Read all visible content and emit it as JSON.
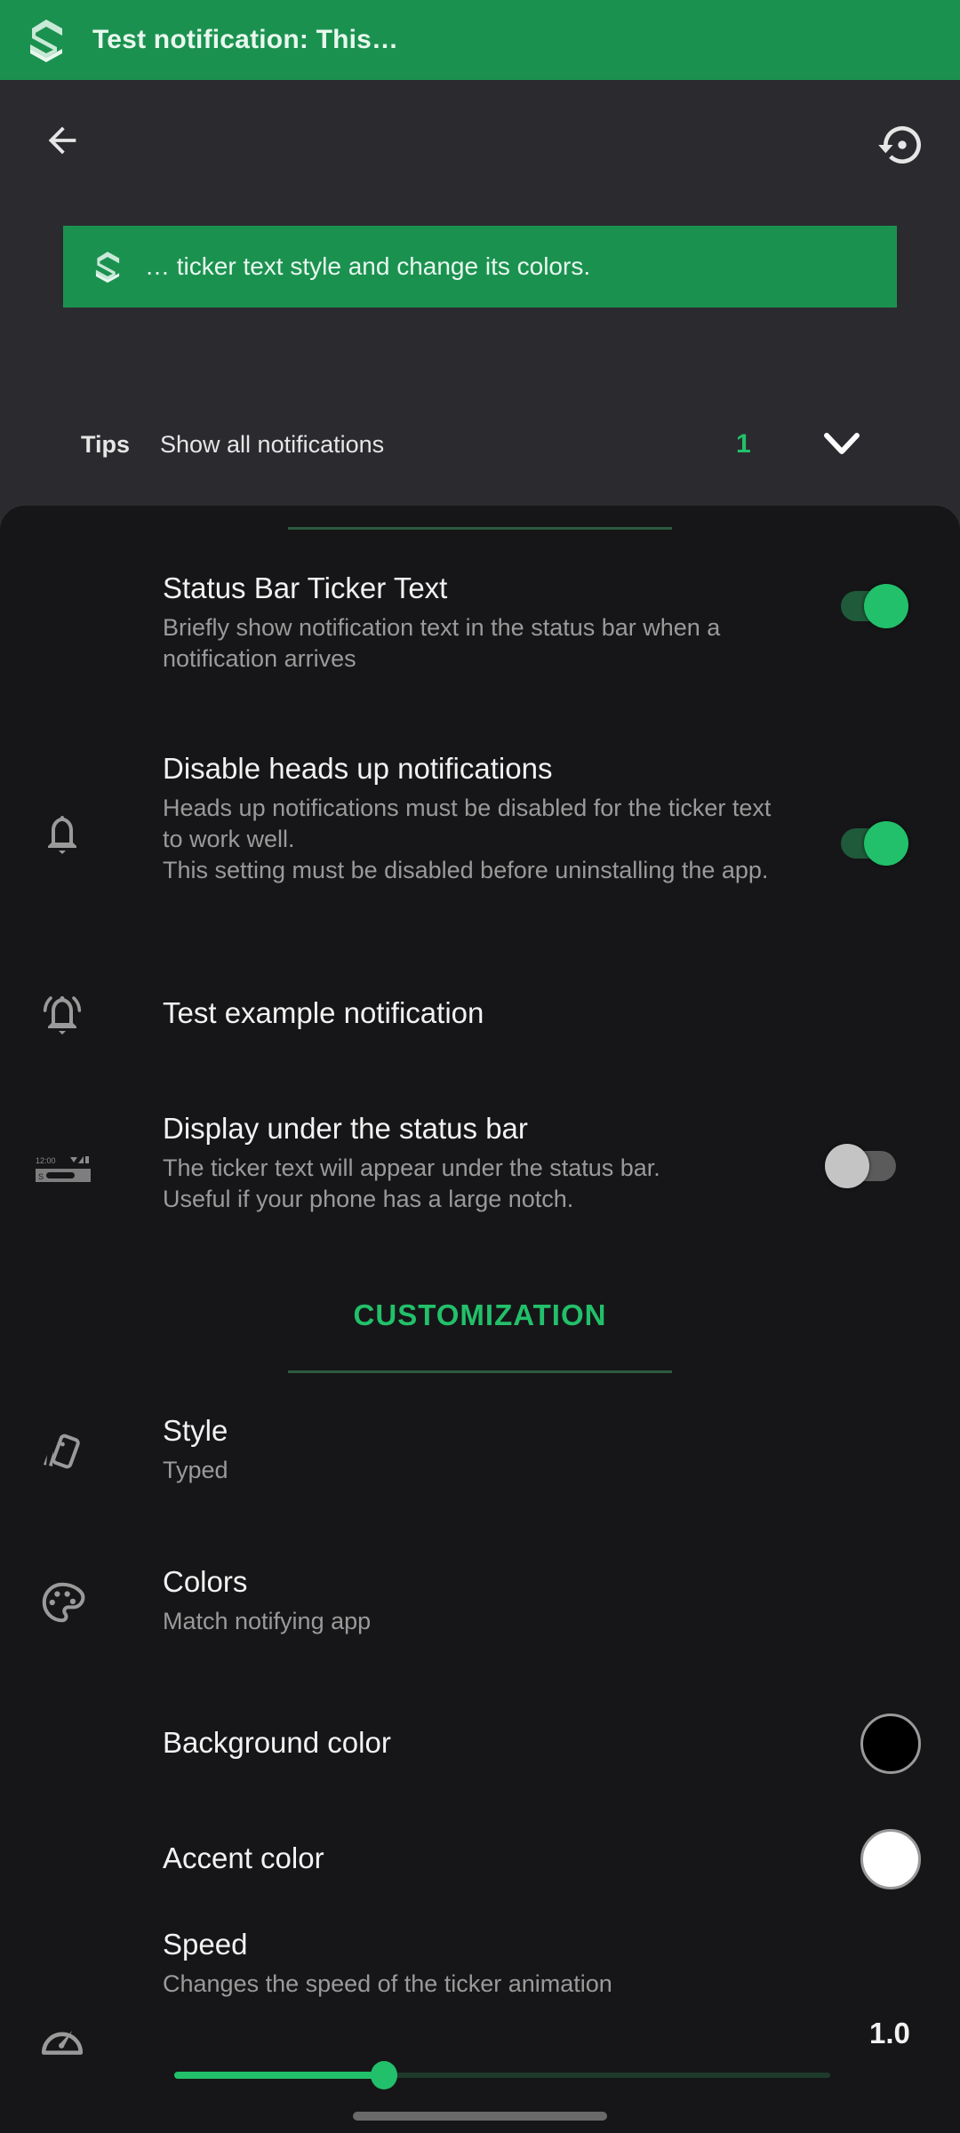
{
  "ticker_notification": {
    "icon": "app-logo-icon",
    "text": "Test notification: This…"
  },
  "header": {
    "back_icon": "arrow-back-icon",
    "reset_icon": "restore-icon",
    "preview_banner": {
      "icon": "app-logo-icon",
      "text": "… ticker text style and change its colors."
    },
    "tips": {
      "label": "Tips",
      "text": "Show all notifications",
      "count": "1",
      "expand_icon": "chevron-down-icon"
    }
  },
  "settings": {
    "status_bar_ticker": {
      "title": "Status Bar Ticker Text",
      "summary": "Briefly show notification text in the status bar when a notification arrives",
      "enabled": true
    },
    "disable_heads_up": {
      "icon": "bell-icon",
      "title": "Disable heads up notifications",
      "summary_line1": "Heads up notifications must be disabled for the ticker text to work well.",
      "summary_line2": "This setting must be disabled before uninstalling the app.",
      "enabled": true
    },
    "test_notification": {
      "icon": "bell-ringing-icon",
      "title": "Test example notification"
    },
    "display_under_status_bar": {
      "icon": "status-bar-preview-icon",
      "icon_time": "12:00",
      "title": "Display under the status bar",
      "summary_line1": "The ticker text will appear under the status bar.",
      "summary_line2": "Useful if your phone has a large notch.",
      "enabled": false
    }
  },
  "customization": {
    "section_title": "CUSTOMIZATION",
    "style": {
      "icon": "cards-icon",
      "title": "Style",
      "value": "Typed"
    },
    "colors": {
      "icon": "palette-icon",
      "title": "Colors",
      "value": "Match notifying app"
    },
    "background_color": {
      "title": "Background color",
      "color": "#000000"
    },
    "accent_color": {
      "title": "Accent color",
      "color": "#ffffff"
    },
    "speed": {
      "icon": "speedometer-icon",
      "title": "Speed",
      "summary": "Changes the speed of the ticker animation",
      "value_label": "1.0",
      "slider_fraction": 0.32
    }
  },
  "theme": {
    "accent": "#22c06a",
    "banner_green": "#1b9150",
    "header_bg": "#2b2b2f",
    "sheet_bg": "#161618"
  }
}
